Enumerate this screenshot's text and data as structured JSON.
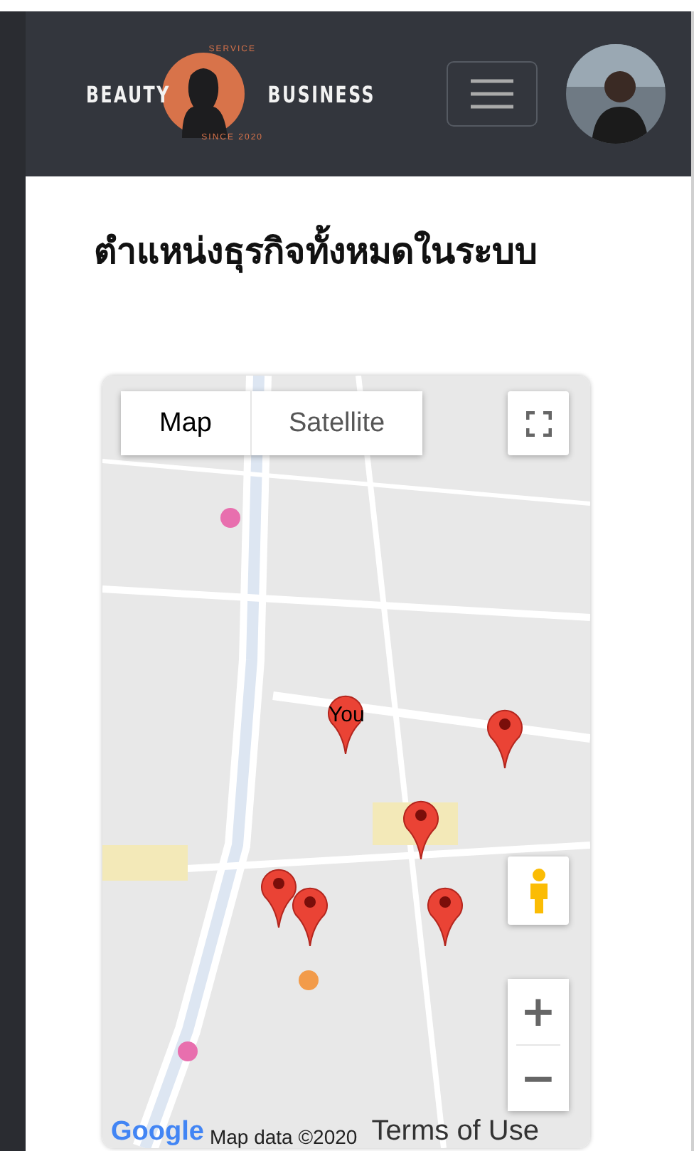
{
  "header": {
    "logo": {
      "top": "SERVICE",
      "left": "BEAUTY",
      "right": "BUSINESS",
      "bottom": "SINCE 2020"
    },
    "menu_expanded": false
  },
  "title": "ตำแหน่งธุรกิจทั้งหมดในระบบ",
  "map": {
    "kind": "picture",
    "map_types": [
      {
        "label": "Map",
        "selected": true
      },
      {
        "label": "Satellite",
        "selected": false
      }
    ],
    "markers": [
      {
        "kind": "labeled",
        "label": "You"
      },
      {
        "kind": "plain"
      },
      {
        "kind": "plain"
      },
      {
        "kind": "plain"
      },
      {
        "kind": "plain"
      },
      {
        "kind": "plain"
      }
    ],
    "zoom": {
      "in": "+",
      "out": "−"
    },
    "attribution": {
      "logo": "Google",
      "data": "Map data ©2020",
      "terms": "Terms of Use"
    }
  }
}
